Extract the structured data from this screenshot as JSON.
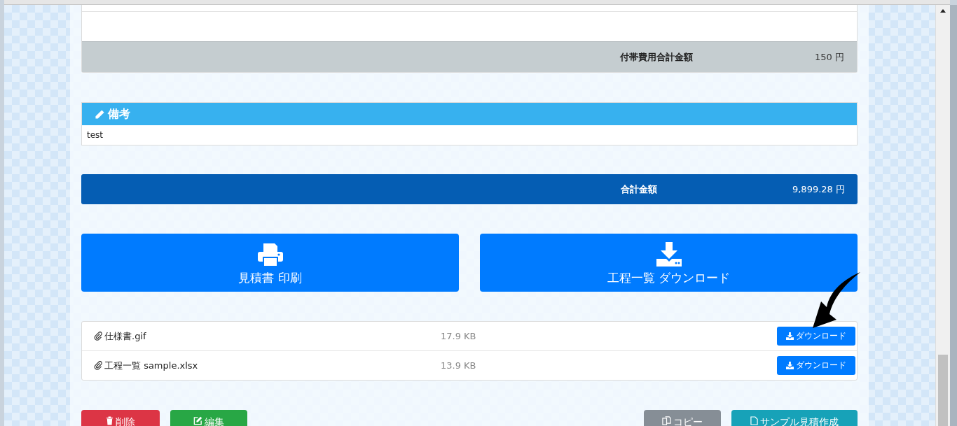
{
  "extras_total": {
    "label": "付帯費用合計金額",
    "amount": "150 円"
  },
  "notes": {
    "title": "備考",
    "body": "test"
  },
  "grand_total": {
    "label": "合計金額",
    "amount": "9,899.28 円"
  },
  "big_buttons": [
    {
      "kind": "print",
      "label": "見積書 印刷"
    },
    {
      "kind": "download",
      "label": "工程一覧 ダウンロード"
    }
  ],
  "attachments": [
    {
      "name": "仕様書.gif",
      "size": "17.9 KB",
      "button": "ダウンロード"
    },
    {
      "name": "工程一覧 sample.xlsx",
      "size": "13.9 KB",
      "button": "ダウンロード"
    }
  ],
  "actions_left": [
    {
      "kind": "delete",
      "label": "削除"
    },
    {
      "kind": "edit",
      "label": "編集"
    }
  ],
  "actions_right": [
    {
      "kind": "copy",
      "label": "コピー"
    },
    {
      "kind": "sample",
      "label": "サンプル見積作成"
    }
  ]
}
